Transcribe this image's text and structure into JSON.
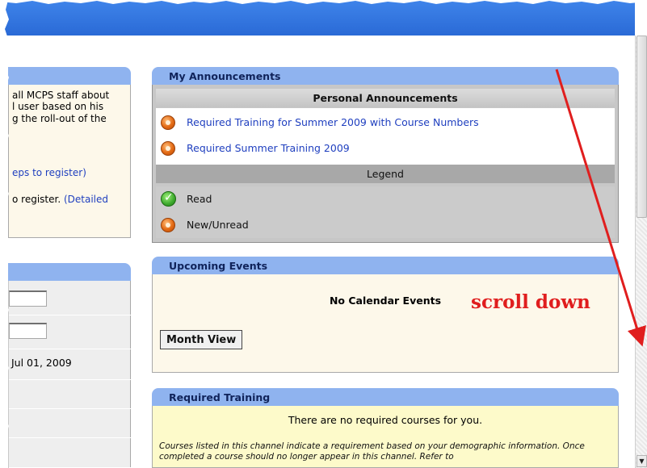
{
  "left_panel_top": {
    "lines": [
      "all MCPS staff about",
      "l user based on his",
      "g the roll-out of the"
    ],
    "link1": "eps to register)",
    "line_text": "o register.",
    "link2": "(Detailed"
  },
  "left_panel_bottom": {
    "date": "Jul 01, 2009"
  },
  "announcements": {
    "title": "My Announcements",
    "subheader": "Personal Announcements",
    "items": [
      {
        "label": "Required Training for Summer 2009 with Course Numbers",
        "icon": "new-unread-icon"
      },
      {
        "label": "Required Summer Training 2009",
        "icon": "new-unread-icon"
      }
    ],
    "legend_title": "Legend",
    "legend": [
      {
        "label": "Read",
        "icon": "read-check-icon"
      },
      {
        "label": "New/Unread",
        "icon": "new-unread-icon"
      }
    ]
  },
  "events": {
    "title": "Upcoming Events",
    "empty_text": "No Calendar Events",
    "button": "Month View"
  },
  "required_training": {
    "title": "Required Training",
    "empty_text": "There are no required courses for you.",
    "note": "Courses listed in this channel indicate a requirement based on your demographic information. Once completed a course should no longer appear in this channel. Refer to"
  },
  "annotation": {
    "text": "scroll down",
    "color": "#e01e1e"
  },
  "colors": {
    "banner": "#2a6ad6",
    "panel_header": "#8fb3ef",
    "link": "#1f3fbf"
  }
}
